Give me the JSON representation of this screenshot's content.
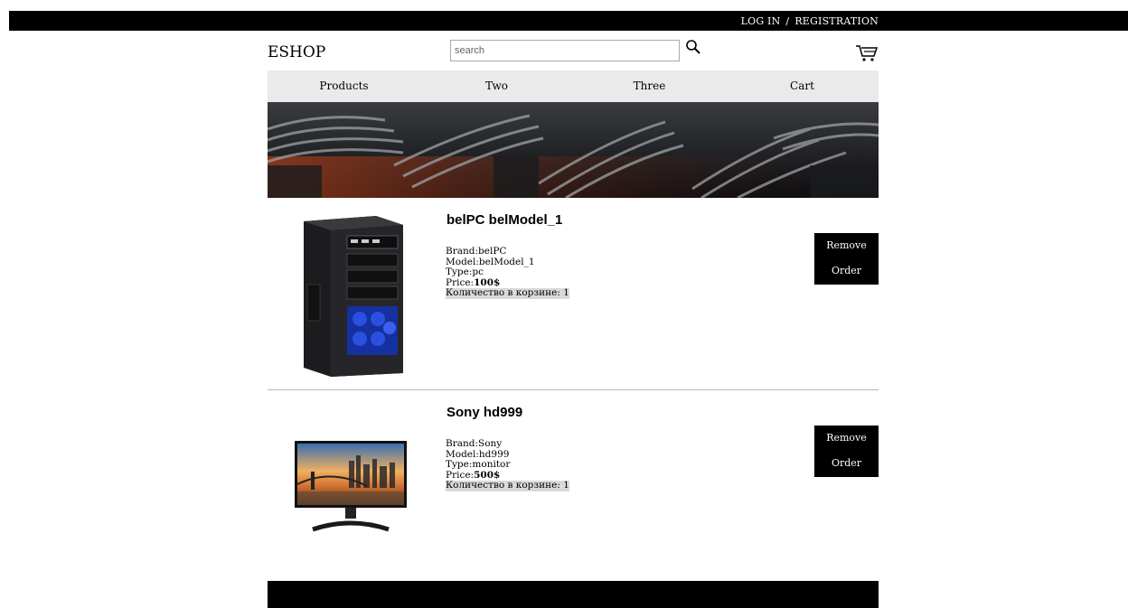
{
  "topbar": {
    "login": "LOG IN",
    "separator": "/",
    "registration": "REGISTRATION"
  },
  "header": {
    "logo": "ESHOP",
    "search_placeholder": "search"
  },
  "nav": {
    "items": [
      "Products",
      "Two",
      "Three",
      "Cart"
    ]
  },
  "products": [
    {
      "title": "belPC belModel_1",
      "brand_label": "Brand:",
      "brand": "belPC",
      "model_label": "Model:",
      "model": "belModel_1",
      "type_label": "Type:",
      "type": "pc",
      "price_label": "Price:",
      "price": "100$",
      "qty_text": "Количество в корзине: 1",
      "btn_line1": "Remove",
      "btn_line2": "Order"
    },
    {
      "title": "Sony hd999",
      "brand_label": "Brand:",
      "brand": "Sony",
      "model_label": "Model:",
      "model": "hd999",
      "type_label": "Type:",
      "type": "monitor",
      "price_label": "Price:",
      "price": "500$",
      "qty_text": "Количество в корзине: 1",
      "btn_line1": "Remove",
      "btn_line2": "Order"
    }
  ],
  "icons": {
    "search": "search-icon",
    "cart": "cart-icon"
  },
  "colors": {
    "topbar": "#000000",
    "nav_bg": "#eaeaea",
    "button_bg": "#000000",
    "qty_highlight": "#d9d9d9"
  }
}
